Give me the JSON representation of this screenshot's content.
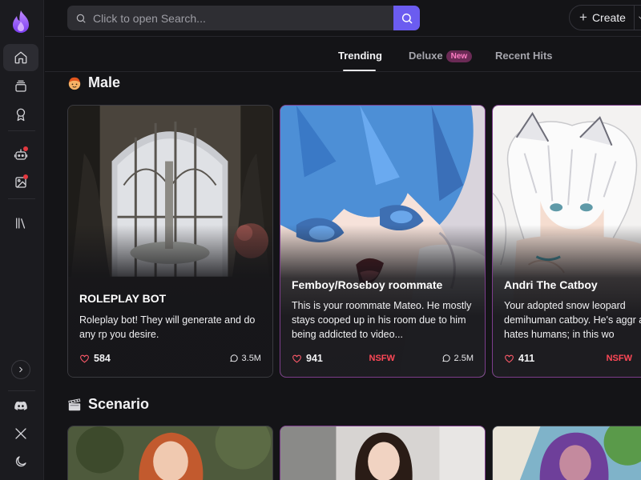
{
  "search": {
    "placeholder": "Click to open Search..."
  },
  "header": {
    "create_label": "Create"
  },
  "tabs": [
    {
      "label": "Trending",
      "active": true
    },
    {
      "label": "Deluxe",
      "badge": "New"
    },
    {
      "label": "Recent Hits"
    }
  ],
  "sections": {
    "male": {
      "title": "Male",
      "emoji_icon": "boy-face-icon"
    },
    "scenario": {
      "title": "Scenario",
      "emoji_icon": "clapper-board-icon"
    }
  },
  "cards": [
    {
      "title": "ROLEPLAY BOT",
      "description": "Roleplay bot! They will generate and do any rp you desire.",
      "likes": "584",
      "nsfw": "",
      "chats": "3.5M"
    },
    {
      "title": "Femboy/Roseboy roommate",
      "description": "This is your roommate Mateo. He mostly stays cooped up in his room due to him being addicted to video...",
      "likes": "941",
      "nsfw": "NSFW",
      "chats": "2.5M"
    },
    {
      "title": "Andri The Catboy",
      "description": "Your adopted snow leopard demihuman catboy. He's aggr and hates humans; in this wo",
      "likes": "411",
      "nsfw": "NSFW",
      "chats": ""
    }
  ],
  "colors": {
    "accent": "#6b5cf0",
    "nsfw": "#ff4857",
    "like": "#ff5a6a",
    "badge_bg": "#6a2a55",
    "badge_text": "#ff7dc4"
  }
}
